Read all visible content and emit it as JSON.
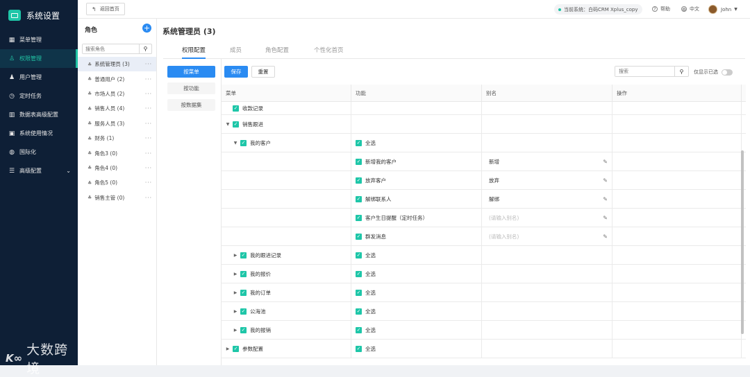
{
  "sidebar": {
    "title": "系统设置",
    "items": [
      {
        "label": "菜单管理",
        "icon": "grid-icon"
      },
      {
        "label": "权限管理",
        "icon": "user-icon"
      },
      {
        "label": "用户管理",
        "icon": "user-manage-icon"
      },
      {
        "label": "定时任务",
        "icon": "clock-icon"
      },
      {
        "label": "数据表高级配置",
        "icon": "bar-chart-icon"
      },
      {
        "label": "系统使用情况",
        "icon": "monitor-icon"
      },
      {
        "label": "国际化",
        "icon": "globe-icon"
      },
      {
        "label": "高级配置",
        "icon": "settings-icon"
      }
    ],
    "watermark": "大数跨境"
  },
  "topbar": {
    "back_label": "返回首页",
    "current_system": "当前系统：白码CRM Xplus_copy",
    "help_label": "帮助",
    "lang_label": "中文",
    "user_name": "John"
  },
  "roles": {
    "header": "角色",
    "search_placeholder": "搜索角色",
    "items": [
      "系统管理员 (3)",
      "普通用户 (2)",
      "市场人员 (2)",
      "销售人员 (4)",
      "服务人员 (3)",
      "财务 (1)",
      "角色3 (0)",
      "角色4 (0)",
      "角色5 (0)",
      "销售主管 (0)"
    ]
  },
  "main": {
    "title": "系统管理员 (3)",
    "tabs": [
      "权限配置",
      "成员",
      "角色配置",
      "个性化首页"
    ],
    "left_tabs": [
      "按菜单",
      "按功能",
      "按数据集"
    ],
    "save_label": "保存",
    "reset_label": "重置",
    "search_placeholder": "搜索",
    "only_selected_label": "仅显示已选"
  },
  "table": {
    "headers": [
      "菜单",
      "功能",
      "别名",
      "操作"
    ],
    "rows": [
      {
        "menu": "收款记录",
        "func": "",
        "alias": ""
      },
      {
        "menu": "销售跟进",
        "func": "",
        "alias": ""
      },
      {
        "menu": "我的客户",
        "func": "全选",
        "alias": ""
      },
      {
        "menu": "",
        "func": "新增我的客户",
        "alias": "新增"
      },
      {
        "menu": "",
        "func": "放弃客户",
        "alias": "放弃"
      },
      {
        "menu": "",
        "func": "解绑联系人",
        "alias": "解绑"
      },
      {
        "menu": "",
        "func": "客户生日提醒（定时任务）",
        "alias": "(请输入别名)"
      },
      {
        "menu": "",
        "func": "群发消息",
        "alias": "(请输入别名)"
      },
      {
        "menu": "我的跟进记录",
        "func": "全选",
        "alias": ""
      },
      {
        "menu": "我的报价",
        "func": "全选",
        "alias": ""
      },
      {
        "menu": "我的订单",
        "func": "全选",
        "alias": ""
      },
      {
        "menu": "公海池",
        "func": "全选",
        "alias": ""
      },
      {
        "menu": "我的报销",
        "func": "全选",
        "alias": ""
      },
      {
        "menu": "参数配置",
        "func": "全选",
        "alias": ""
      }
    ]
  }
}
